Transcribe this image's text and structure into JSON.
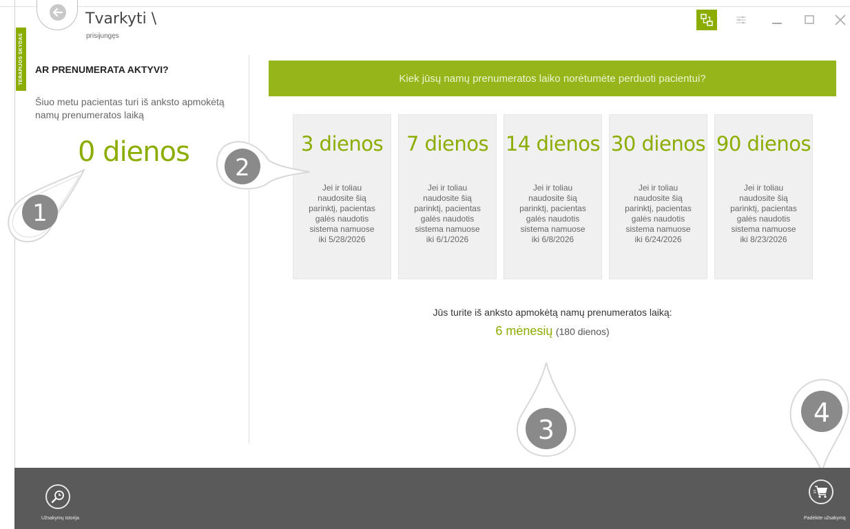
{
  "side_tab": {
    "label": "TERAPIJOS SKYDAS"
  },
  "header": {
    "title": "Tvarkyti \\",
    "subtitle": "prisijungęs"
  },
  "left": {
    "heading": "AR PRENUMERATA AKTYVI?",
    "description": "Šiuo metu pacientas turi iš anksto apmokėtą namų prenumeratos laiką",
    "days_value": "0",
    "days_unit": "dienos"
  },
  "banner": {
    "text": "Kiek jūsų namų prenumeratos laiko norėtumėte perduoti pacientui?"
  },
  "options": [
    {
      "days": "3 dienos",
      "text": "Jei ir toliau naudosite šią parinktį, pacientas galės naudotis sistema namuose iki 5/28/2026"
    },
    {
      "days": "7 dienos",
      "text": "Jei ir toliau naudosite šią parinktį, pacientas galės naudotis sistema namuose iki 6/1/2026"
    },
    {
      "days": "14 dienos",
      "text": "Jei ir toliau naudosite šią parinktį, pacientas galės naudotis sistema namuose iki 6/8/2026"
    },
    {
      "days": "30 dienos",
      "text": "Jei ir toliau naudosite šią parinktį, pacientas galės naudotis sistema namuose iki 6/24/2026"
    },
    {
      "days": "90 dienos",
      "text": "Jei ir toliau naudosite šią parinktį, pacientas galės naudotis sistema namuose iki 8/23/2026"
    }
  ],
  "prepaid": {
    "label": "Jūs turite iš anksto apmokėtą namų prenumeratos laiką:",
    "months": "6 mėnesių",
    "days": "(180 dienos)"
  },
  "bottom": {
    "history_label": "Užsakymų istorija",
    "order_label": "Padėkite užsakymą"
  },
  "markers": [
    "1",
    "2",
    "3",
    "4"
  ],
  "colors": {
    "accent": "#8aad00",
    "banner": "#95b51a",
    "bottombar": "#5a5a5a"
  }
}
